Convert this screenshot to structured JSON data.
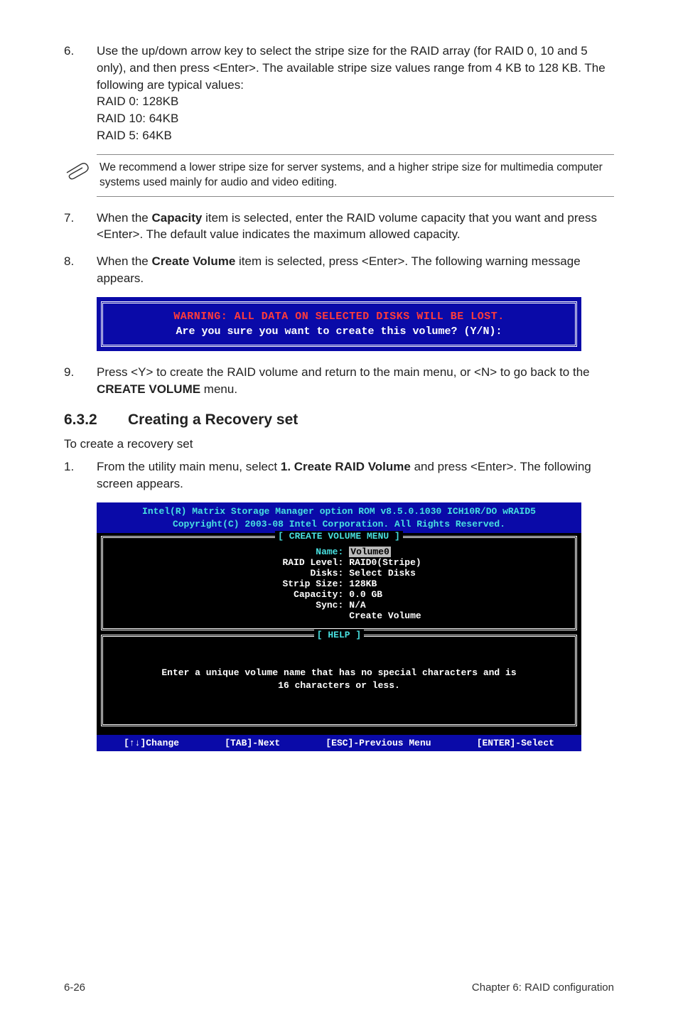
{
  "steps": {
    "s6": {
      "num": "6.",
      "text": "Use the up/down arrow key to select the stripe size for the RAID array (for RAID 0, 10 and 5 only), and then press <Enter>. The available stripe size values range from 4 KB to 128 KB. The following are typical values:",
      "lines": [
        "RAID 0: 128KB",
        "RAID 10: 64KB",
        "RAID 5: 64KB"
      ]
    },
    "note": "We recommend a lower stripe size for server systems, and a higher stripe size for multimedia computer systems used mainly for audio and video editing.",
    "s7": {
      "num": "7.",
      "pre": "When the ",
      "bold": "Capacity",
      "post": " item is selected, enter the RAID volume capacity that you want and press <Enter>. The default value indicates the maximum allowed capacity."
    },
    "s8": {
      "num": "8.",
      "pre": "When the ",
      "bold": "Create Volume",
      "post": " item is selected, press <Enter>. The following warning message appears."
    },
    "dialog": {
      "warn": "WARNING: ALL DATA ON SELECTED DISKS WILL BE LOST.",
      "ask": "Are you sure you want to create this volume? (Y/N):"
    },
    "s9": {
      "num": "9.",
      "pre": "Press <Y> to create the RAID volume and return to the main menu, or <N> to go back to the ",
      "bold": "CREATE VOLUME",
      "post": " menu."
    }
  },
  "section": {
    "num": "6.3.2",
    "title": "Creating a Recovery set",
    "intro": "To create a recovery set",
    "step1": {
      "num": "1.",
      "pre": "From the utility main menu, select ",
      "bold": "1. Create RAID Volume",
      "post": " and press <Enter>. The following screen appears."
    }
  },
  "bios": {
    "header1": "Intel(R) Matrix Storage Manager option ROM v8.5.0.1030 ICH10R/DO wRAID5",
    "header2": "Copyright(C) 2003-08 Intel Corporation.  All Rights Reserved.",
    "menu_title": "[ CREATE VOLUME MENU ]",
    "fields": {
      "name_lbl": "Name:",
      "name_val": "Volume0",
      "raid_lbl": "RAID Level:",
      "raid_val": "RAID0(Stripe)",
      "disks_lbl": "Disks:",
      "disks_val": "Select Disks",
      "strip_lbl": "Strip Size:",
      "strip_val": "128KB",
      "cap_lbl": "Capacity:",
      "cap_val": "0.0   GB",
      "sync_lbl": "Sync:",
      "sync_val": "N/A",
      "create": "Create Volume"
    },
    "help_title": "[ HELP ]",
    "help_text1": "Enter a unique volume name that has no special characters and is",
    "help_text2": "16 characters or less.",
    "footer": {
      "a": "[↑↓]Change",
      "b": "[TAB]-Next",
      "c": "[ESC]-Previous Menu",
      "d": "[ENTER]-Select"
    }
  },
  "page_footer": {
    "left": "6-26",
    "right": "Chapter 6: RAID configuration"
  }
}
